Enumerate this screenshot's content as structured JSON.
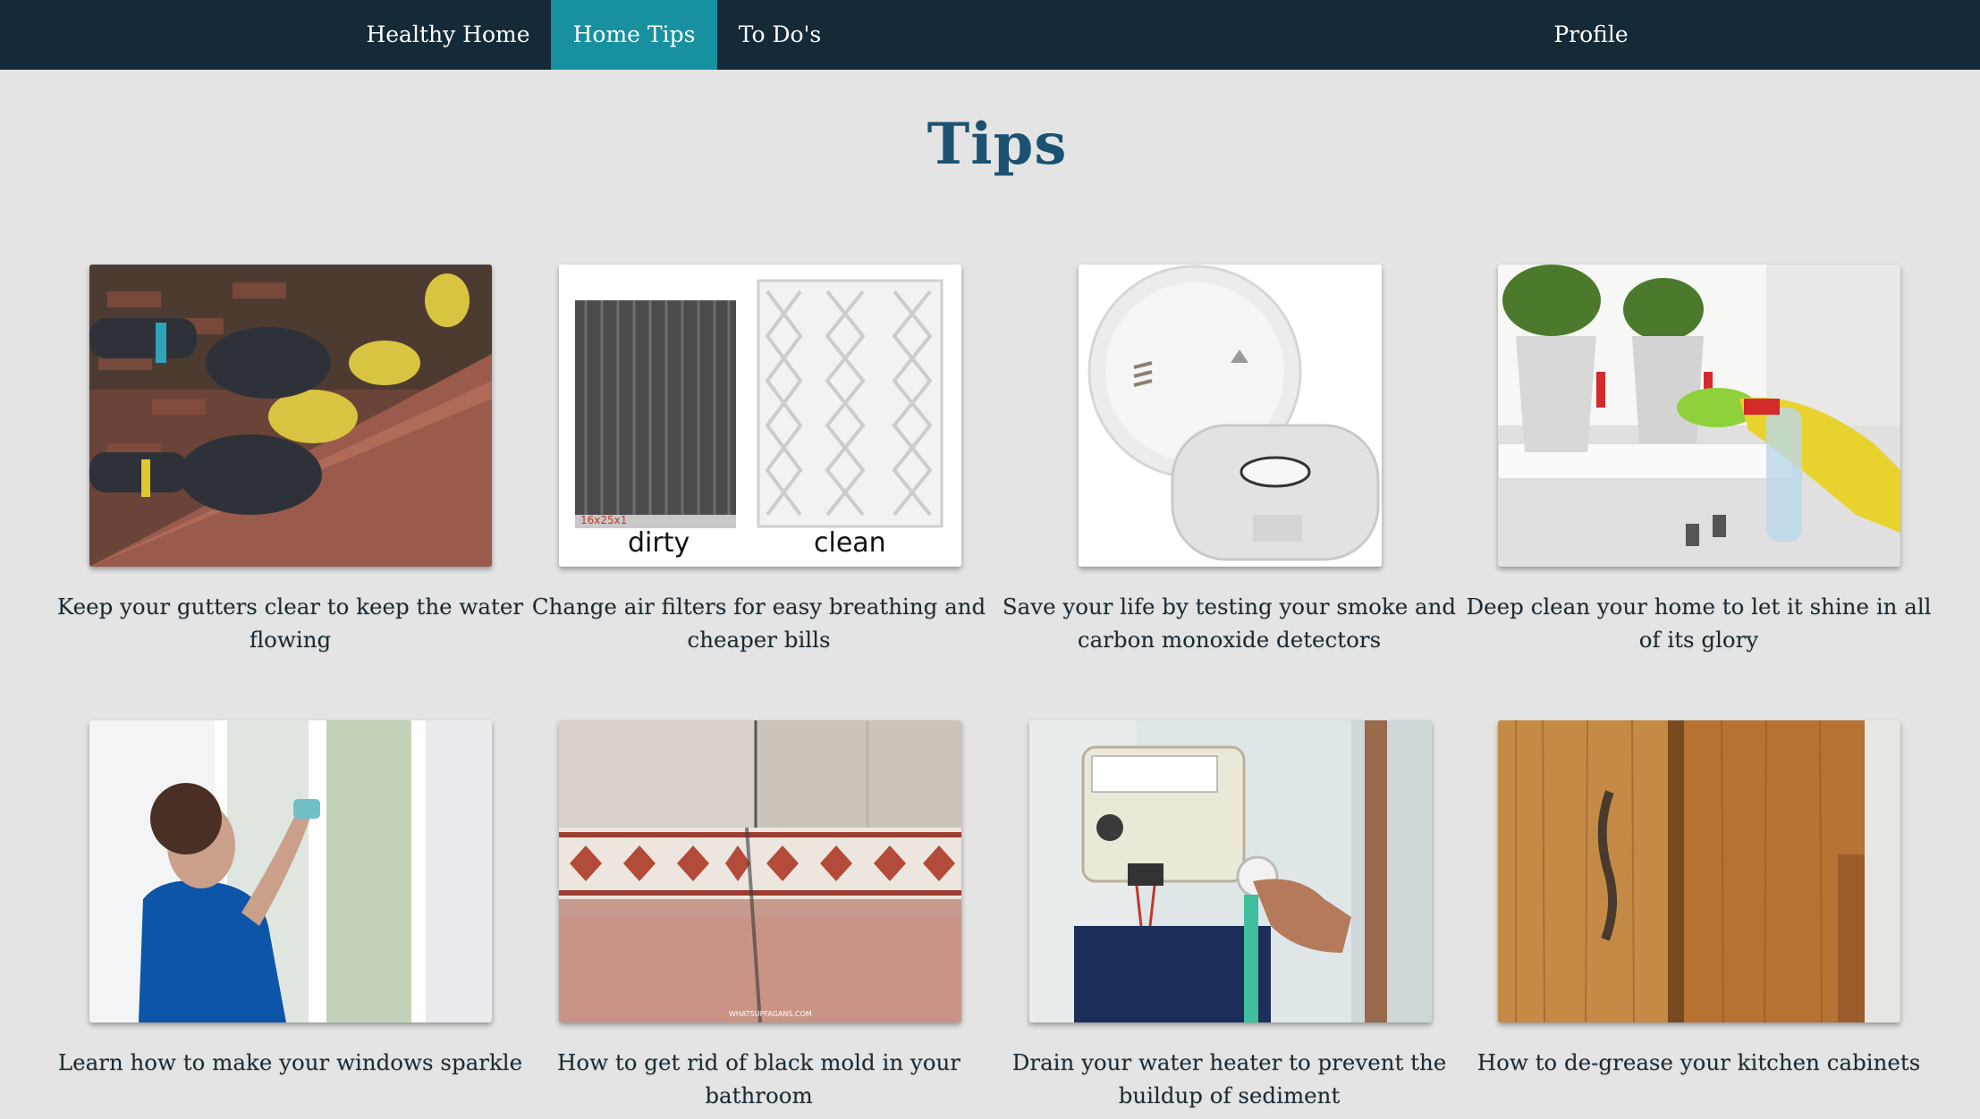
{
  "nav": {
    "items": [
      {
        "label": "Healthy Home",
        "active": false
      },
      {
        "label": "Home Tips",
        "active": true
      },
      {
        "label": "To Do's",
        "active": false
      }
    ],
    "profile_label": "Profile"
  },
  "page": {
    "title": "Tips"
  },
  "tips": [
    {
      "caption": "Keep your gutters clear to keep the water flowing",
      "icon": "gutter-photo"
    },
    {
      "caption": "Change air filters for easy breathing and cheaper bills",
      "icon": "air-filter-photo",
      "labels": {
        "dirty": "dirty",
        "clean": "clean",
        "size": "16x25x1"
      }
    },
    {
      "caption": "Save your life by testing your smoke and carbon monoxide detectors",
      "icon": "detector-photo"
    },
    {
      "caption": "Deep clean your home to let it shine in all of its glory",
      "icon": "cleaning-photo"
    },
    {
      "caption": "Learn how to make your windows sparkle",
      "icon": "window-photo"
    },
    {
      "caption": "How to get rid of black mold in your bathroom",
      "icon": "bathroom-tile-photo",
      "watermark": "WHATSUPFAGANS.COM"
    },
    {
      "caption": "Drain your water heater to prevent the buildup of sediment",
      "icon": "water-heater-photo"
    },
    {
      "caption": "How to de-grease your kitchen cabinets",
      "icon": "cabinet-photo"
    }
  ],
  "colors": {
    "nav_bg": "#152a38",
    "nav_active": "#17919f",
    "page_bg": "#e4e4e4",
    "title": "#1b5272"
  }
}
